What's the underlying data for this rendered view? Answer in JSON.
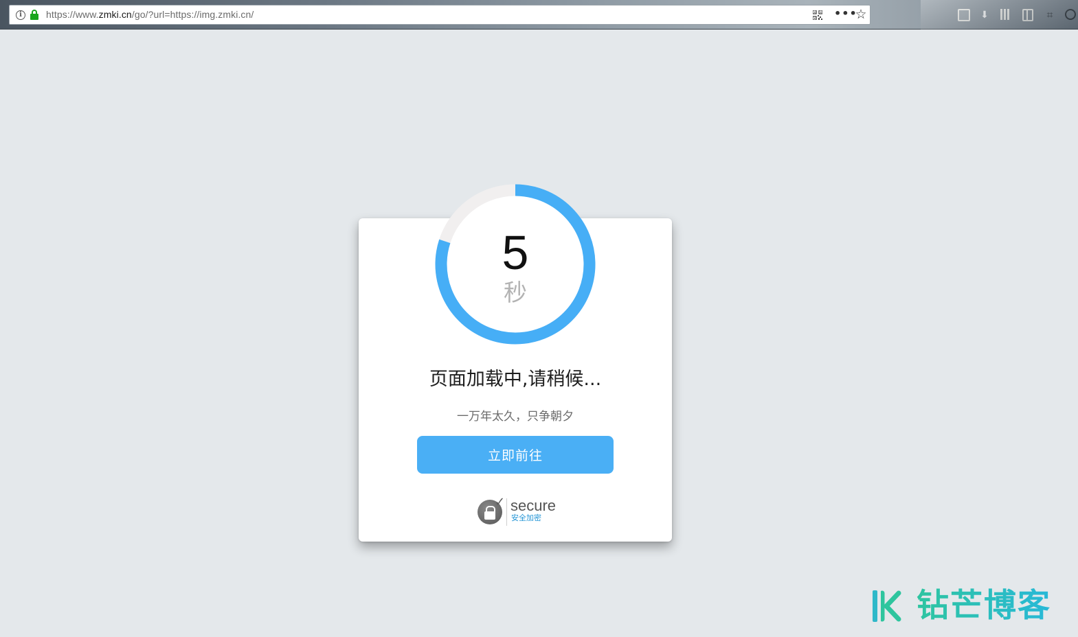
{
  "browser": {
    "url_prefix": "https://www.",
    "url_host": "zmki.cn",
    "url_suffix": "/go/?url=https://img.zmki.cn/",
    "more_label": "•••",
    "star_label": "☆",
    "icons": [
      "info-icon",
      "lock-icon",
      "qr-code-icon",
      "more-actions-icon",
      "bookmark-star-icon",
      "mail-icon",
      "download-icon",
      "library-icon",
      "sidebar-icon",
      "screenshot-icon",
      "extension-icon"
    ]
  },
  "countdown": {
    "seconds": "5",
    "unit": "秒",
    "progress_fraction": 0.8,
    "ring_color": "#46aef6",
    "track_color": "#f1efef"
  },
  "card": {
    "title": "页面加载中,请稍候...",
    "slogan": "一万年太久，只争朝夕",
    "button_label": "立即前往",
    "button_color": "#4aaff5"
  },
  "badge": {
    "secure": "secure",
    "secure_cn": "安全加密"
  },
  "watermark": {
    "brand": "钻芒博客"
  }
}
